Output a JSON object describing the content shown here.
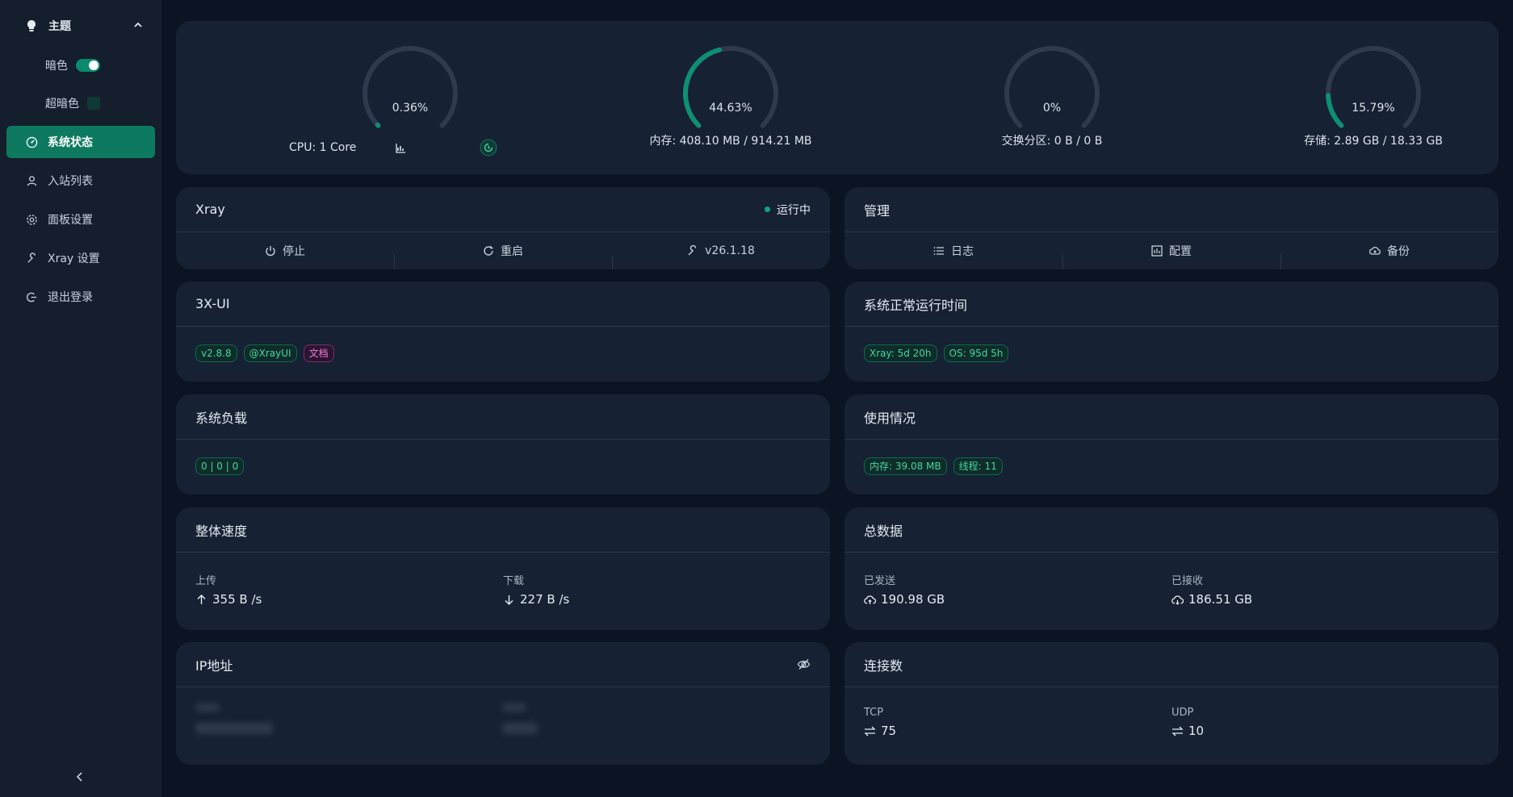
{
  "sidebar": {
    "theme_label": "主题",
    "dark_label": "暗色",
    "ultra_dark_label": "超暗色",
    "items": [
      {
        "label": "系统状态",
        "icon": "dashboard-icon"
      },
      {
        "label": "入站列表",
        "icon": "user-icon"
      },
      {
        "label": "面板设置",
        "icon": "gear-icon"
      },
      {
        "label": "Xray 设置",
        "icon": "tool-icon"
      },
      {
        "label": "退出登录",
        "icon": "logout-icon"
      }
    ]
  },
  "gauges": [
    {
      "value": "0.36%",
      "fraction": 0.0036,
      "label": "CPU: 1 Core"
    },
    {
      "value": "44.63%",
      "fraction": 0.4463,
      "label": "内存: 408.10 MB / 914.21 MB"
    },
    {
      "value": "0%",
      "fraction": 0,
      "label": "交换分区: 0 B / 0 B"
    },
    {
      "value": "15.79%",
      "fraction": 0.1579,
      "label": "存储: 2.89 GB / 18.33 GB"
    }
  ],
  "xray": {
    "title": "Xray",
    "status": "运行中",
    "buttons": [
      "停止",
      "重启",
      "v26.1.18"
    ]
  },
  "manage": {
    "title": "管理",
    "buttons": [
      "日志",
      "配置",
      "备份"
    ]
  },
  "panel": {
    "title": "3X-UI",
    "tags": [
      "v2.8.8",
      "@XrayUI",
      "文档"
    ]
  },
  "uptime": {
    "title": "系统正常运行时间",
    "tags": [
      "Xray: 5d 20h",
      "OS: 95d 5h"
    ]
  },
  "load": {
    "title": "系统负载",
    "tags": [
      "0 | 0 | 0"
    ]
  },
  "usage": {
    "title": "使用情况",
    "tags": [
      "内存: 39.08 MB",
      "线程: 11"
    ]
  },
  "speed": {
    "title": "整体速度",
    "upload_label": "上传",
    "upload_value": "355 B /s",
    "download_label": "下载",
    "download_value": "227 B /s"
  },
  "total": {
    "title": "总数据",
    "sent_label": "已发送",
    "sent_value": "190.98 GB",
    "received_label": "已接收",
    "received_value": "186.51 GB"
  },
  "ip": {
    "title": "IP地址"
  },
  "connections": {
    "title": "连接数",
    "tcp_label": "TCP",
    "tcp_value": "75",
    "udp_label": "UDP",
    "udp_value": "10"
  },
  "colors": {
    "accent": "#0d7a5f",
    "gauge_fill": "#0e8f73",
    "gauge_track": "#2f3a4e",
    "background": "#0c1423",
    "card": "#162133"
  }
}
